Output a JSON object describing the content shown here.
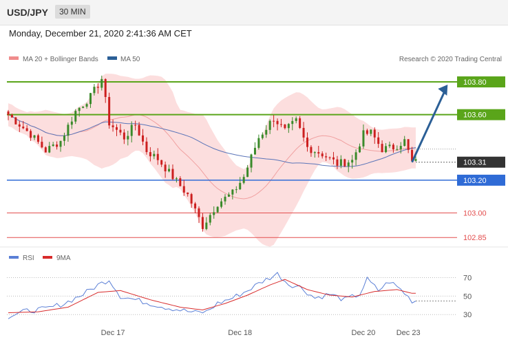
{
  "header": {
    "pair": "USD/JPY",
    "timeframe": "30 MIN",
    "datetime": "Monday, December 21, 2020 2:41:36 AM CET"
  },
  "legend": {
    "bollinger": "MA 20 + Bollinger Bands",
    "ma50": "MA 50",
    "copyright": "Research © 2020 Trading Central"
  },
  "rsi_legend": {
    "rsi": "RSI",
    "ma9": "9MA"
  },
  "colors": {
    "up": "#3a8a2a",
    "down": "#cc1f1f",
    "resistance": "#5aa51a",
    "support": "#2f6bd6",
    "minor_level": "#e34d4d",
    "current": "#333333",
    "ma50": "#5a74b8",
    "band_fill": "#fbd3d3",
    "arrow": "#2b5f96",
    "rsi": "#5a7fd6",
    "rsi_ma": "#d82b2b"
  },
  "chart_data": {
    "type": "candlestick",
    "y_range": [
      102.83,
      103.88
    ],
    "levels": [
      {
        "label": "103.80",
        "value": 103.8,
        "kind": "resistance"
      },
      {
        "label": "103.60",
        "value": 103.6,
        "kind": "resistance"
      },
      {
        "label": "103.31",
        "value": 103.31,
        "kind": "current"
      },
      {
        "label": "103.20",
        "value": 103.2,
        "kind": "support"
      },
      {
        "label": "103.00",
        "value": 103.0,
        "kind": "minor"
      },
      {
        "label": "102.85",
        "value": 102.85,
        "kind": "minor"
      }
    ],
    "x_labels": [
      {
        "label": "Dec 17",
        "index": 28
      },
      {
        "label": "Dec 18",
        "index": 62
      },
      {
        "label": "Dec 20",
        "index": 95
      },
      {
        "label": "Dec 23",
        "index": 107
      }
    ],
    "candle_count": 110,
    "price_path": [
      [
        0,
        103.6
      ],
      [
        6,
        103.48
      ],
      [
        10,
        103.38
      ],
      [
        14,
        103.44
      ],
      [
        18,
        103.62
      ],
      [
        22,
        103.71
      ],
      [
        25,
        103.82
      ],
      [
        27,
        103.55
      ],
      [
        31,
        103.46
      ],
      [
        34,
        103.54
      ],
      [
        37,
        103.38
      ],
      [
        40,
        103.33
      ],
      [
        44,
        103.22
      ],
      [
        48,
        103.11
      ],
      [
        52,
        102.92
      ],
      [
        56,
        103.06
      ],
      [
        60,
        103.12
      ],
      [
        63,
        103.22
      ],
      [
        67,
        103.46
      ],
      [
        71,
        103.58
      ],
      [
        74,
        103.5
      ],
      [
        77,
        103.56
      ],
      [
        80,
        103.4
      ],
      [
        84,
        103.36
      ],
      [
        88,
        103.3
      ],
      [
        92,
        103.32
      ],
      [
        95,
        103.48
      ],
      [
        97,
        103.49
      ],
      [
        100,
        103.39
      ],
      [
        103,
        103.4
      ],
      [
        106,
        103.44
      ],
      [
        108,
        103.31
      ]
    ],
    "forecast_arrow": {
      "from_index": 108,
      "from_value": 103.31,
      "to_index": 119,
      "to_value": 103.8
    },
    "rsi": {
      "y_range": [
        22,
        80
      ],
      "ticks": [
        70,
        50,
        30
      ],
      "path": [
        [
          0,
          28
        ],
        [
          5,
          34
        ],
        [
          10,
          36
        ],
        [
          15,
          42
        ],
        [
          20,
          52
        ],
        [
          24,
          62
        ],
        [
          27,
          68
        ],
        [
          30,
          50
        ],
        [
          34,
          46
        ],
        [
          38,
          42
        ],
        [
          42,
          38
        ],
        [
          46,
          35
        ],
        [
          50,
          32
        ],
        [
          53,
          33
        ],
        [
          56,
          42
        ],
        [
          60,
          48
        ],
        [
          64,
          56
        ],
        [
          68,
          66
        ],
        [
          72,
          74
        ],
        [
          75,
          63
        ],
        [
          78,
          60
        ],
        [
          82,
          48
        ],
        [
          86,
          52
        ],
        [
          90,
          46
        ],
        [
          94,
          52
        ],
        [
          96,
          68
        ],
        [
          99,
          56
        ],
        [
          102,
          66
        ],
        [
          105,
          57
        ],
        [
          108,
          45
        ]
      ],
      "ma_path": [
        [
          0,
          32
        ],
        [
          8,
          33
        ],
        [
          16,
          38
        ],
        [
          24,
          54
        ],
        [
          30,
          56
        ],
        [
          38,
          46
        ],
        [
          46,
          38
        ],
        [
          52,
          35
        ],
        [
          58,
          42
        ],
        [
          64,
          51
        ],
        [
          70,
          62
        ],
        [
          74,
          68
        ],
        [
          80,
          57
        ],
        [
          86,
          51
        ],
        [
          92,
          49
        ],
        [
          98,
          55
        ],
        [
          104,
          57
        ],
        [
          108,
          53
        ]
      ]
    }
  }
}
